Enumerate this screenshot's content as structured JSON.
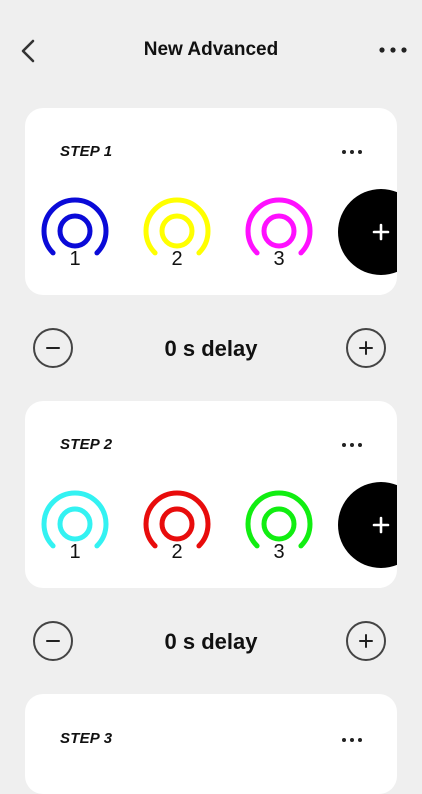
{
  "header": {
    "title": "New Advanced",
    "back_icon": "chevron-left-icon",
    "more_icon": "more-horizontal-icon"
  },
  "steps": [
    {
      "label": "STEP 1",
      "lights": [
        {
          "number": "1",
          "color": "#0a0ad8"
        },
        {
          "number": "2",
          "color": "#ffff00"
        },
        {
          "number": "3",
          "color": "#ff10ff"
        }
      ]
    },
    {
      "label": "STEP 2",
      "lights": [
        {
          "number": "1",
          "color": "#33f2f2"
        },
        {
          "number": "2",
          "color": "#e80c0c"
        },
        {
          "number": "3",
          "color": "#11ee11"
        }
      ]
    },
    {
      "label": "STEP 3",
      "lights": []
    }
  ],
  "delays": [
    {
      "text": "0 s delay"
    },
    {
      "text": "0 s delay"
    }
  ],
  "colors": {
    "background": "#efefef",
    "card": "#ffffff",
    "add_button": "#000000"
  }
}
